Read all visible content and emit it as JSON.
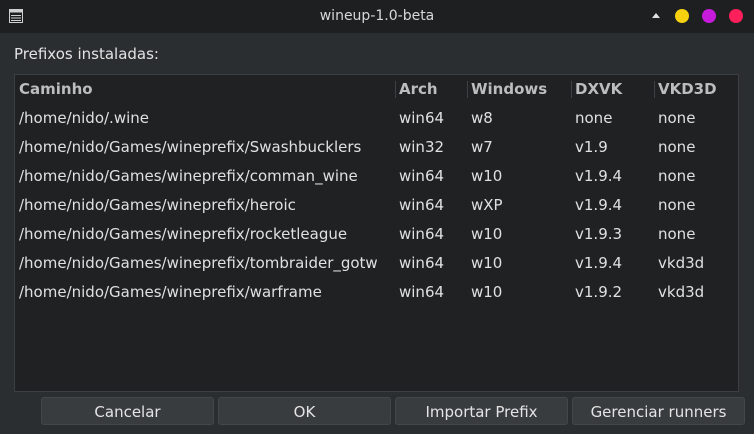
{
  "window": {
    "title": "wineup-1.0-beta",
    "controls": {
      "minimize_color": "#f7d10f",
      "maximize_color": "#c71bdc",
      "close_color": "#ff1f5a"
    }
  },
  "main": {
    "label": "Prefixos instaladas:",
    "columns": [
      "Caminho",
      "Arch",
      "Windows",
      "DXVK",
      "VKD3D"
    ],
    "rows": [
      [
        "/home/nido/.wine",
        "win64",
        "w8",
        "none",
        "none"
      ],
      [
        "/home/nido/Games/wineprefix/Swashbucklers",
        "win32",
        "w7",
        "v1.9",
        "none"
      ],
      [
        "/home/nido/Games/wineprefix/comman_wine",
        "win64",
        "w10",
        "v1.9.4",
        "none"
      ],
      [
        "/home/nido/Games/wineprefix/heroic",
        "win64",
        "wXP",
        "v1.9.4",
        "none"
      ],
      [
        "/home/nido/Games/wineprefix/rocketleague",
        "win64",
        "w10",
        "v1.9.3",
        "none"
      ],
      [
        "/home/nido/Games/wineprefix/tombraider_gotw",
        "win64",
        "w10",
        "v1.9.4",
        "vkd3d"
      ],
      [
        "/home/nido/Games/wineprefix/warframe",
        "win64",
        "w10",
        "v1.9.2",
        "vkd3d"
      ]
    ]
  },
  "buttons": {
    "cancel": "Cancelar",
    "ok": "OK",
    "import": "Importar Prefix",
    "manage": "Gerenciar runners"
  }
}
